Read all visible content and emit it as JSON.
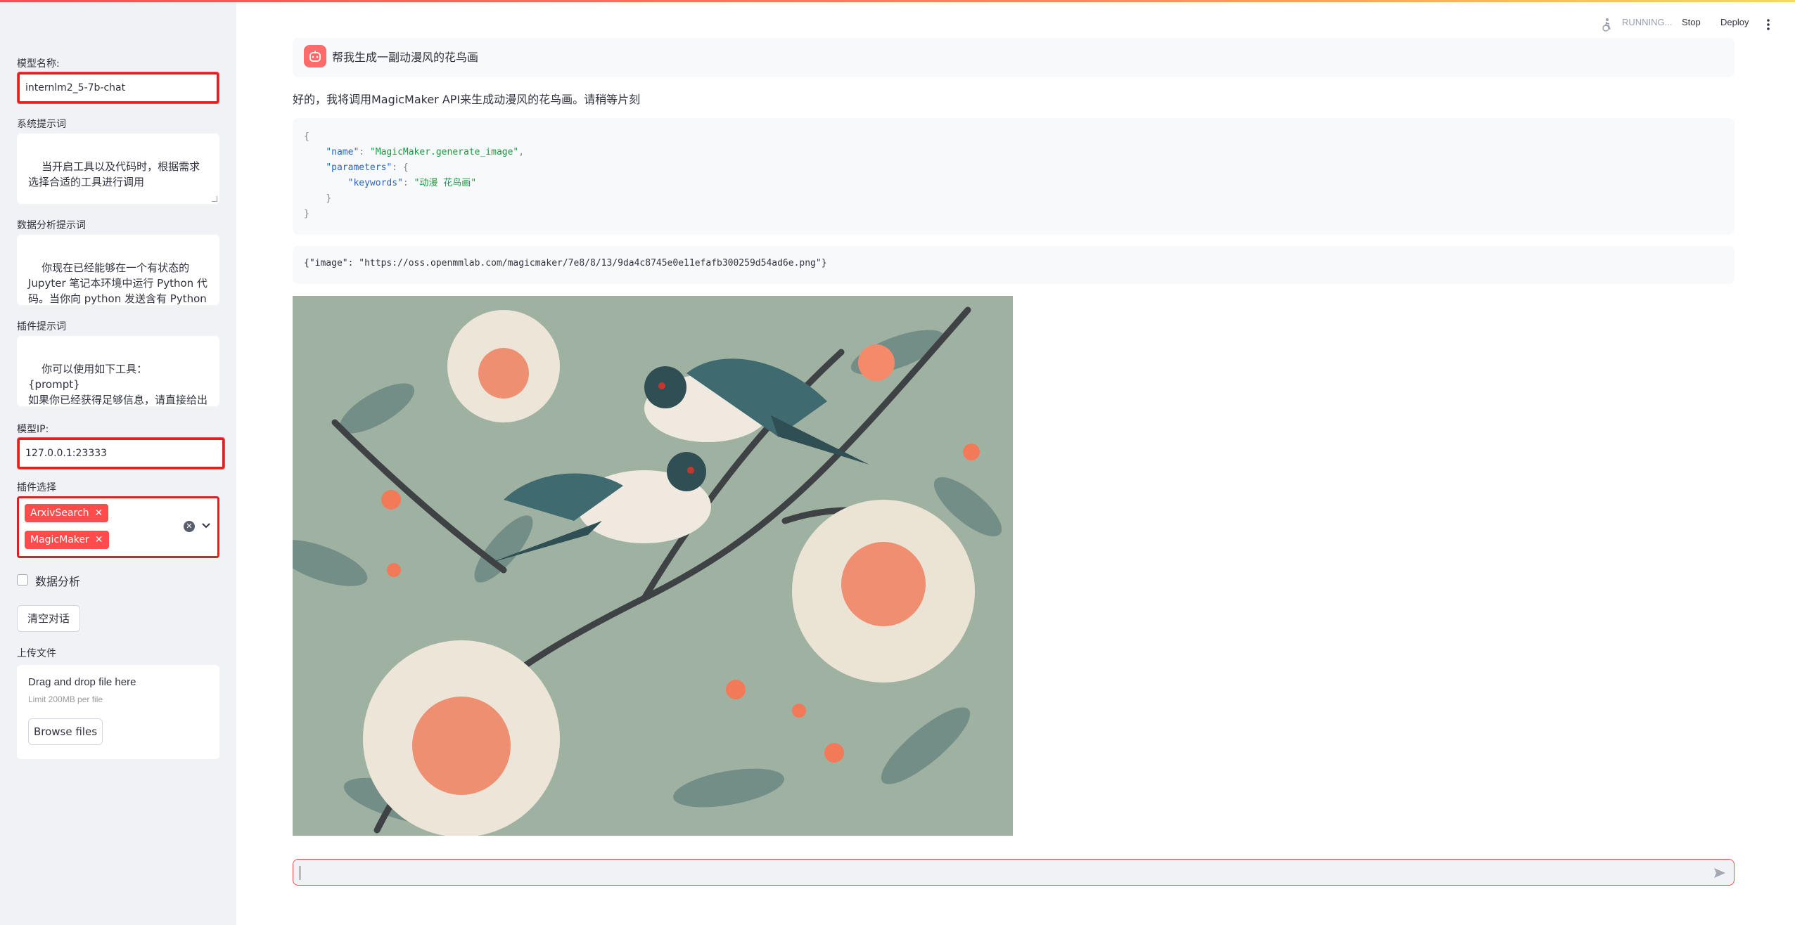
{
  "sidebar": {
    "model_name_label": "模型名称:",
    "model_name_value": "internlm2_5-7b-chat",
    "system_prompt_label": "系统提示词",
    "system_prompt_value": "当开启工具以及代码时，根据需求选择合适的工具进行调用",
    "data_analysis_prompt_label": "数据分析提示词",
    "data_analysis_prompt_value": "你现在已经能够在一个有状态的 Jupyter 笔记本环境中运行 Python 代码。当你向 python 发送含有 Python 代码的消息时，它将在该环",
    "plugin_prompt_label": "插件提示词",
    "plugin_prompt_value": "你可以使用如下工具：\n{prompt}\n如果你已经获得足够信息，请直接给出答案. 避免不必要的工具调用!",
    "model_ip_label": "模型IP:",
    "model_ip_value": "127.0.0.1:23333",
    "plugin_select_label": "插件选择",
    "plugins_selected": [
      "ArxivSearch",
      "MagicMaker"
    ],
    "data_analysis_checkbox_label": "数据分析",
    "clear_chat_label": "清空对话",
    "upload_label": "上传文件",
    "uploader": {
      "title": "Drag and drop file here",
      "limit": "Limit 200MB per file",
      "browse_label": "Browse files"
    }
  },
  "toolbar": {
    "status": "RUNNING...",
    "stop_label": "Stop",
    "deploy_label": "Deploy"
  },
  "chat": {
    "user_message": "帮我生成一副动漫风的花鸟画",
    "assistant_message": "好的，我将调用MagicMaker API来生成动漫风的花鸟画。请稍等片刻",
    "code": {
      "name_key": "\"name\"",
      "name_value": "\"MagicMaker.generate_image\"",
      "params_key": "\"parameters\"",
      "keywords_key": "\"keywords\"",
      "keywords_value": "\"动漫 花鸟画\""
    },
    "result": "{\"image\": \"https://oss.openmmlab.com/magicmaker/7e8/8/13/9da4c8745e0e11efafb300259d54ad6e.png\"}",
    "input_placeholder": ""
  },
  "colors": {
    "accent": "#ff4b4b",
    "sidebar_bg": "#f0f2f6",
    "highlight_border": "#e02020"
  },
  "icons": {
    "status": "running-figure-icon",
    "menu": "kebab-menu-icon",
    "send": "send-icon",
    "avatar": "robot-avatar-icon"
  }
}
